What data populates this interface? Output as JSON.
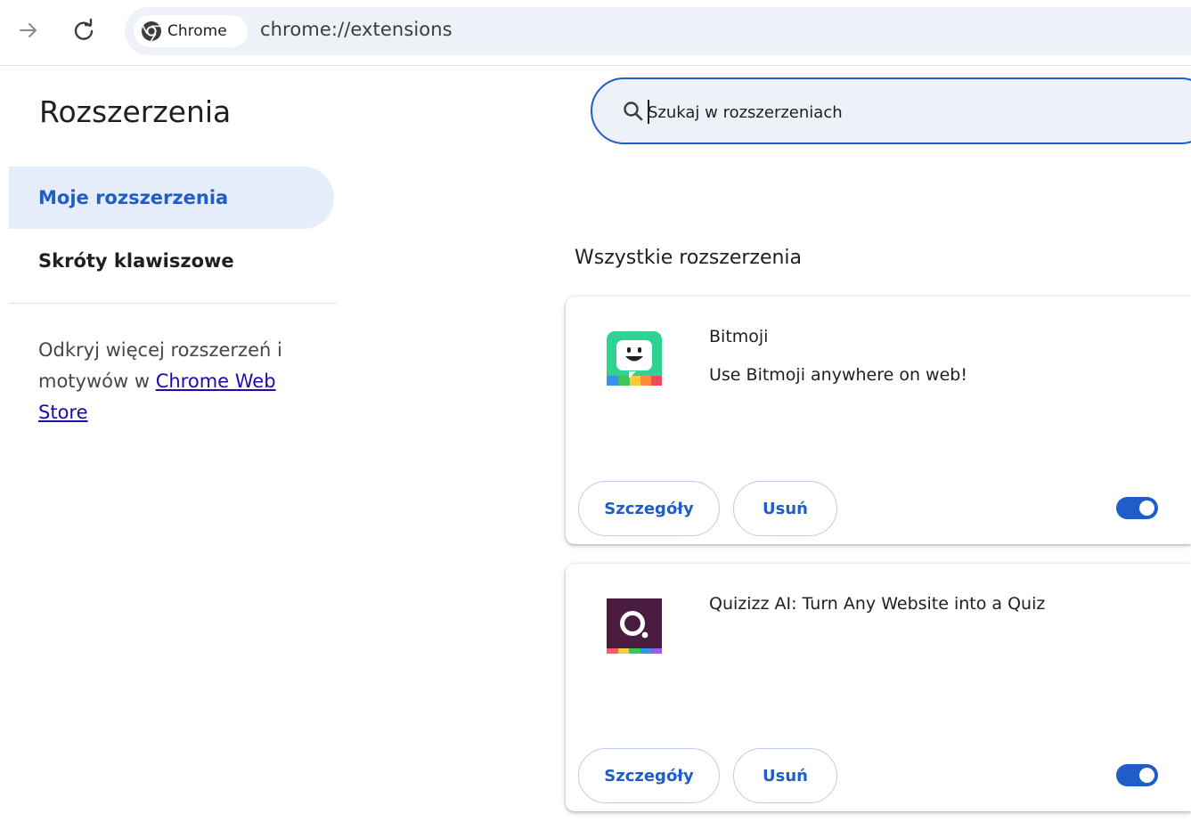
{
  "browser": {
    "chip_label": "Chrome",
    "url": "chrome://extensions"
  },
  "sidebar": {
    "title": "Rozszerzenia",
    "items": [
      {
        "label": "Moje rozszerzenia",
        "active": true
      },
      {
        "label": "Skróty klawiszowe",
        "active": false
      }
    ],
    "promo_text": "Odkryj więcej rozszerzeń i motywów w",
    "promo_link": "Chrome Web Store"
  },
  "search": {
    "placeholder": "Szukaj w rozszerzeniach"
  },
  "main": {
    "section_title": "Wszystkie rozszerzenia",
    "extensions": [
      {
        "name": "Bitmoji",
        "description": "Use Bitmoji anywhere on web!",
        "icon": "bitmoji-icon",
        "details_label": "Szczegóły",
        "remove_label": "Usuń",
        "enabled": true
      },
      {
        "name": "Quizizz AI: Turn Any Website into a Quiz",
        "description": "",
        "icon": "quizizz-icon",
        "details_label": "Szczegóły",
        "remove_label": "Usuń",
        "enabled": true
      }
    ]
  },
  "colors": {
    "accent": "#1f5ec8",
    "nav_active_bg": "#e6edfa",
    "omnibox_bg": "#eef2f8"
  }
}
